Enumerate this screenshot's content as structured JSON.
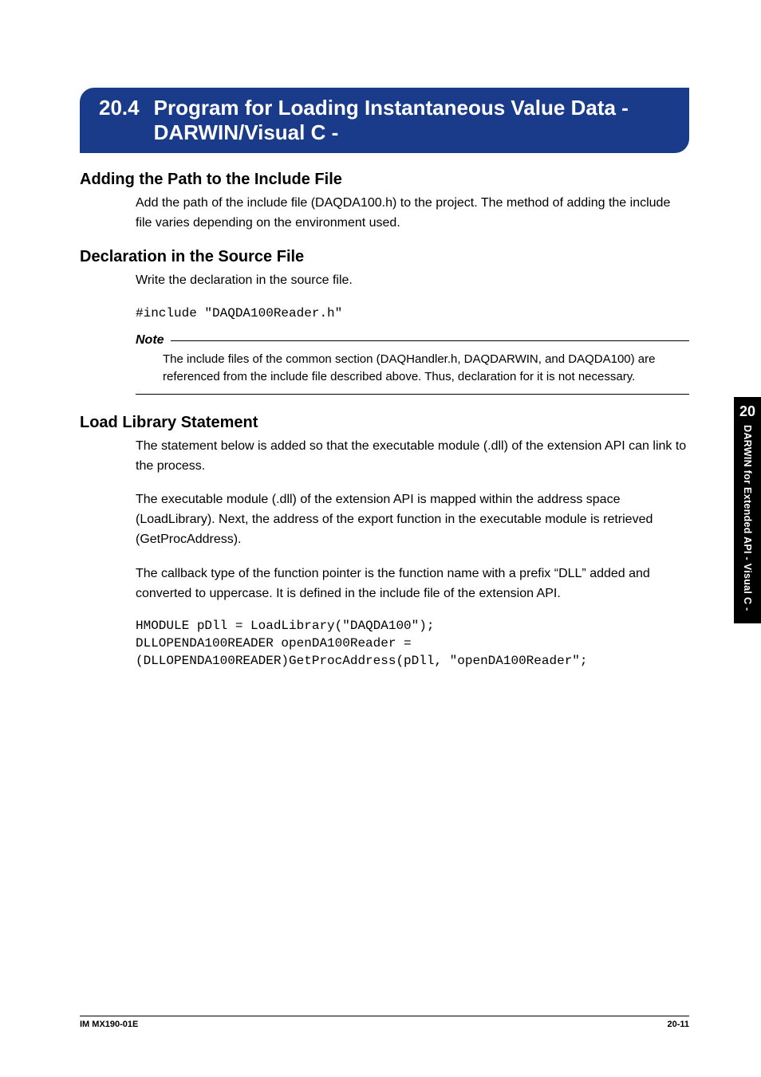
{
  "title": {
    "number": "20.4",
    "text": "Program for Loading Instantaneous Value Data - DARWIN/Visual C -"
  },
  "sections": {
    "addingPath": {
      "heading": "Adding the Path to the Include File",
      "para": "Add the path of the include file (DAQDA100.h) to the project. The method of adding the include file varies depending on the environment used."
    },
    "declaration": {
      "heading": "Declaration in the Source File",
      "para": "Write the declaration in the source file.",
      "code": "#include \"DAQDA100Reader.h\""
    },
    "note": {
      "label": "Note",
      "body": "The include files of the common section (DAQHandler.h, DAQDARWIN, and DAQDA100) are referenced from the include file described above. Thus, declaration for it is not necessary."
    },
    "loadLibrary": {
      "heading": "Load Library Statement",
      "para1": "The statement below is added so that the executable module (.dll) of the extension API can link to the process.",
      "para2": "The executable module (.dll) of the extension API is mapped within the address space (LoadLibrary). Next, the address of the export function in the executable module is retrieved (GetProcAddress).",
      "para3": "The callback type of the function pointer is the function name with a prefix “DLL” added and converted to uppercase. It is defined in the include file of the extension API.",
      "code": "HMODULE pDll = LoadLibrary(\"DAQDA100\");\nDLLOPENDA100READER openDA100Reader =\n(DLLOPENDA100READER)GetProcAddress(pDll, \"openDA100Reader\";"
    }
  },
  "sideTab": {
    "number": "20",
    "text": "DARWIN for Extended API - Visual C -"
  },
  "footer": {
    "left": "IM MX190-01E",
    "right": "20-11"
  }
}
